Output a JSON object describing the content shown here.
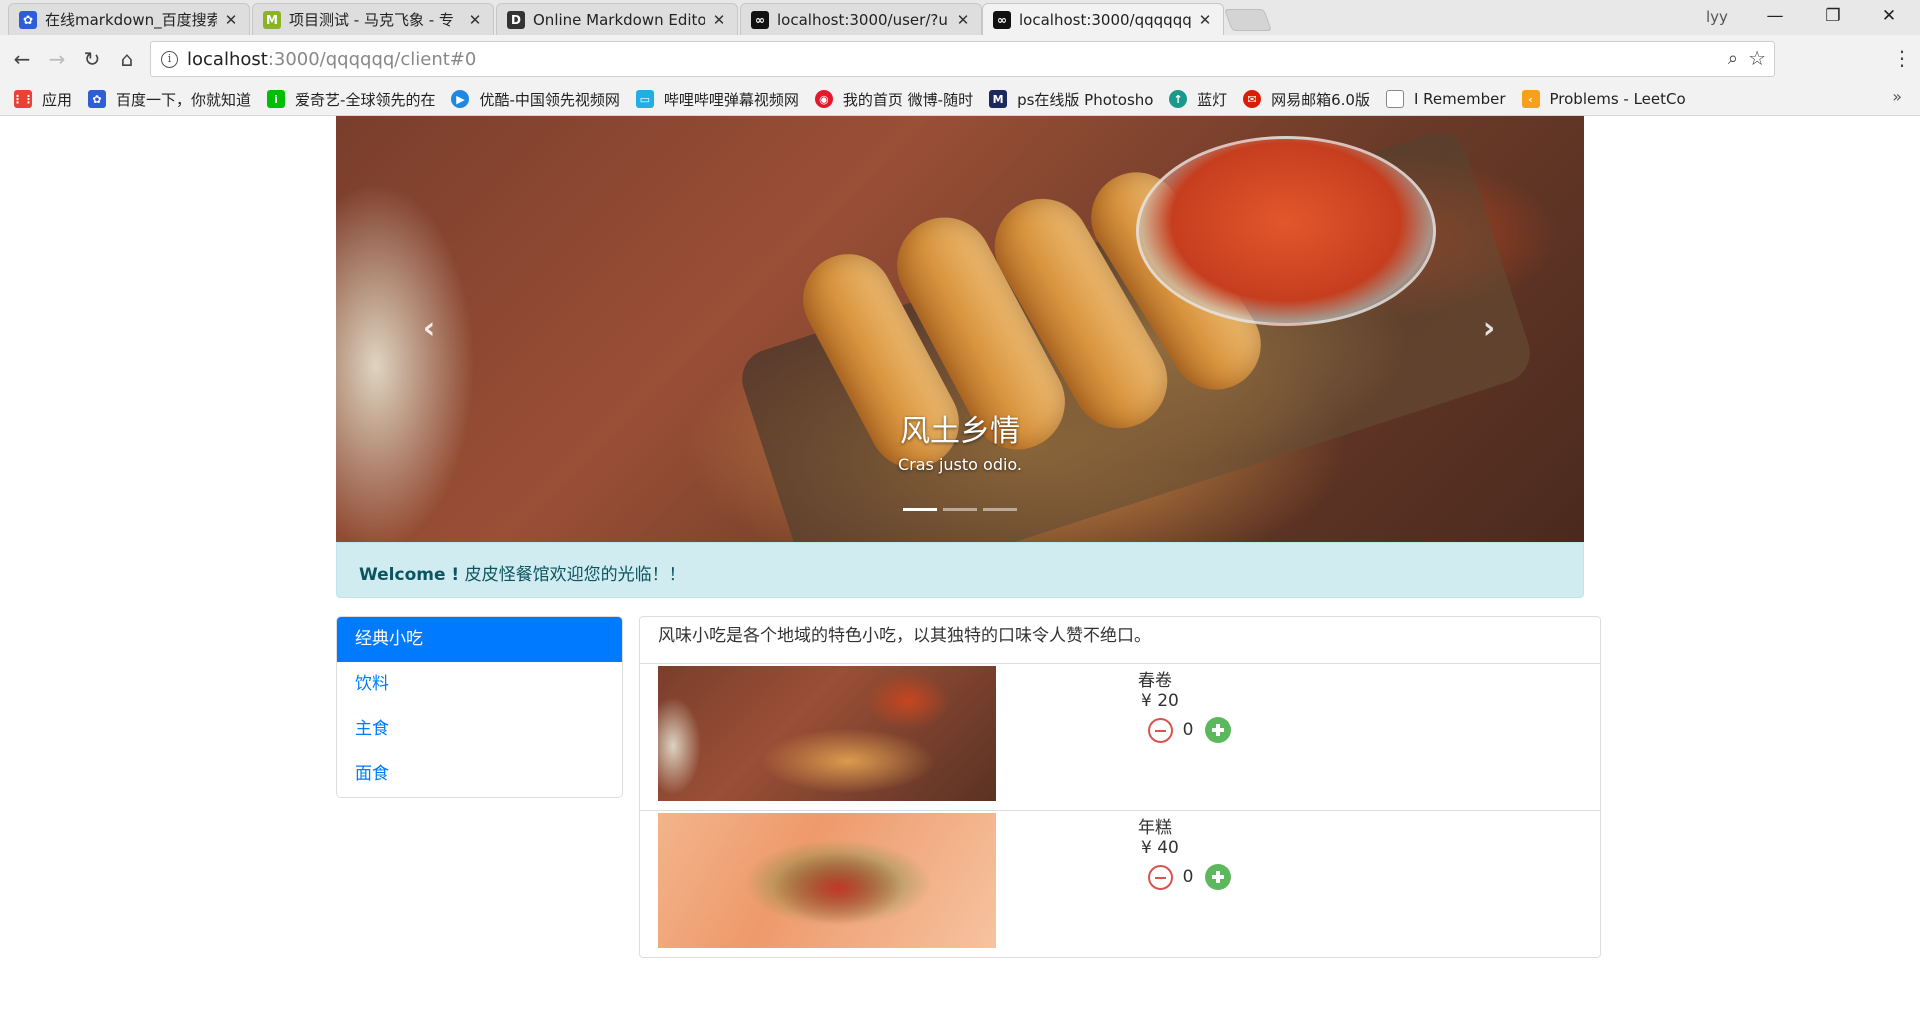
{
  "browser": {
    "tabs": [
      {
        "title": "在线markdown_百度搜索",
        "icon": "baidu-icon",
        "color": "#2d5ed8"
      },
      {
        "title": "项目测试 - 马克飞象 - 专",
        "icon": "maxiang-icon",
        "color": "#8bb327"
      },
      {
        "title": "Online Markdown Editor",
        "icon": "dillinger-icon",
        "color": "#333333"
      },
      {
        "title": "localhost:3000/user/?u",
        "icon": "app-icon",
        "color": "#111111"
      },
      {
        "title": "localhost:3000/qqqqqq",
        "icon": "app-icon",
        "color": "#111111"
      }
    ],
    "close_glyph": "✕",
    "profile": "lyy",
    "url_host": "localhost",
    "url_path": ":3000/qqqqqq/client#0",
    "bookmarks": [
      {
        "label": "应用",
        "icon": "apps-grid-icon",
        "color": "#e94235"
      },
      {
        "label": "百度一下，你就知道",
        "icon": "baidu-icon",
        "color": "#2d5ed8"
      },
      {
        "label": "爱奇艺-全球领先的在",
        "icon": "iqiyi-icon",
        "color": "#00be06"
      },
      {
        "label": "优酷-中国领先视频网",
        "icon": "youku-icon",
        "color": "#1e88e5"
      },
      {
        "label": "哔哩哔哩弹幕视频网",
        "icon": "bilibili-icon",
        "color": "#23ade5"
      },
      {
        "label": "我的首页 微博-随时",
        "icon": "weibo-icon",
        "color": "#e6162d"
      },
      {
        "label": "ps在线版 Photosho",
        "icon": "photoshop-icon",
        "color": "#1b2a5c"
      },
      {
        "label": "蓝灯",
        "icon": "lantern-icon",
        "color": "#1a9a8a"
      },
      {
        "label": "网易邮箱6.0版",
        "icon": "netease-icon",
        "color": "#d81e06"
      },
      {
        "label": "I Remember",
        "icon": "page-icon",
        "color": "#888888"
      },
      {
        "label": "Problems - LeetCo",
        "icon": "leetcode-icon",
        "color": "#f89f1b"
      }
    ]
  },
  "carousel": {
    "title": "风土乡情",
    "subtitle": "Cras justo odio.",
    "prev": "‹",
    "next": "›",
    "slide_count": 3,
    "active_slide": 0
  },
  "welcome": {
    "strong": "Welcome !",
    "text": " 皮皮怪餐馆欢迎您的光临！！"
  },
  "categories": [
    {
      "label": "经典小吃",
      "active": true
    },
    {
      "label": "饮料",
      "active": false
    },
    {
      "label": "主食",
      "active": false
    },
    {
      "label": "面食",
      "active": false
    }
  ],
  "menu": {
    "description": "风味小吃是各个地域的特色小吃，以其独特的口味令人赞不绝口。",
    "currency": "¥",
    "items": [
      {
        "name": "春卷",
        "price": "¥ 20",
        "qty": "0"
      },
      {
        "name": "年糕",
        "price": "¥ 40",
        "qty": "0"
      }
    ]
  },
  "colors": {
    "primary": "#007bff",
    "alert_bg": "#d1ecf1",
    "alert_text": "#0c5460",
    "minus": "#d9534f",
    "plus": "#5cb85c"
  }
}
